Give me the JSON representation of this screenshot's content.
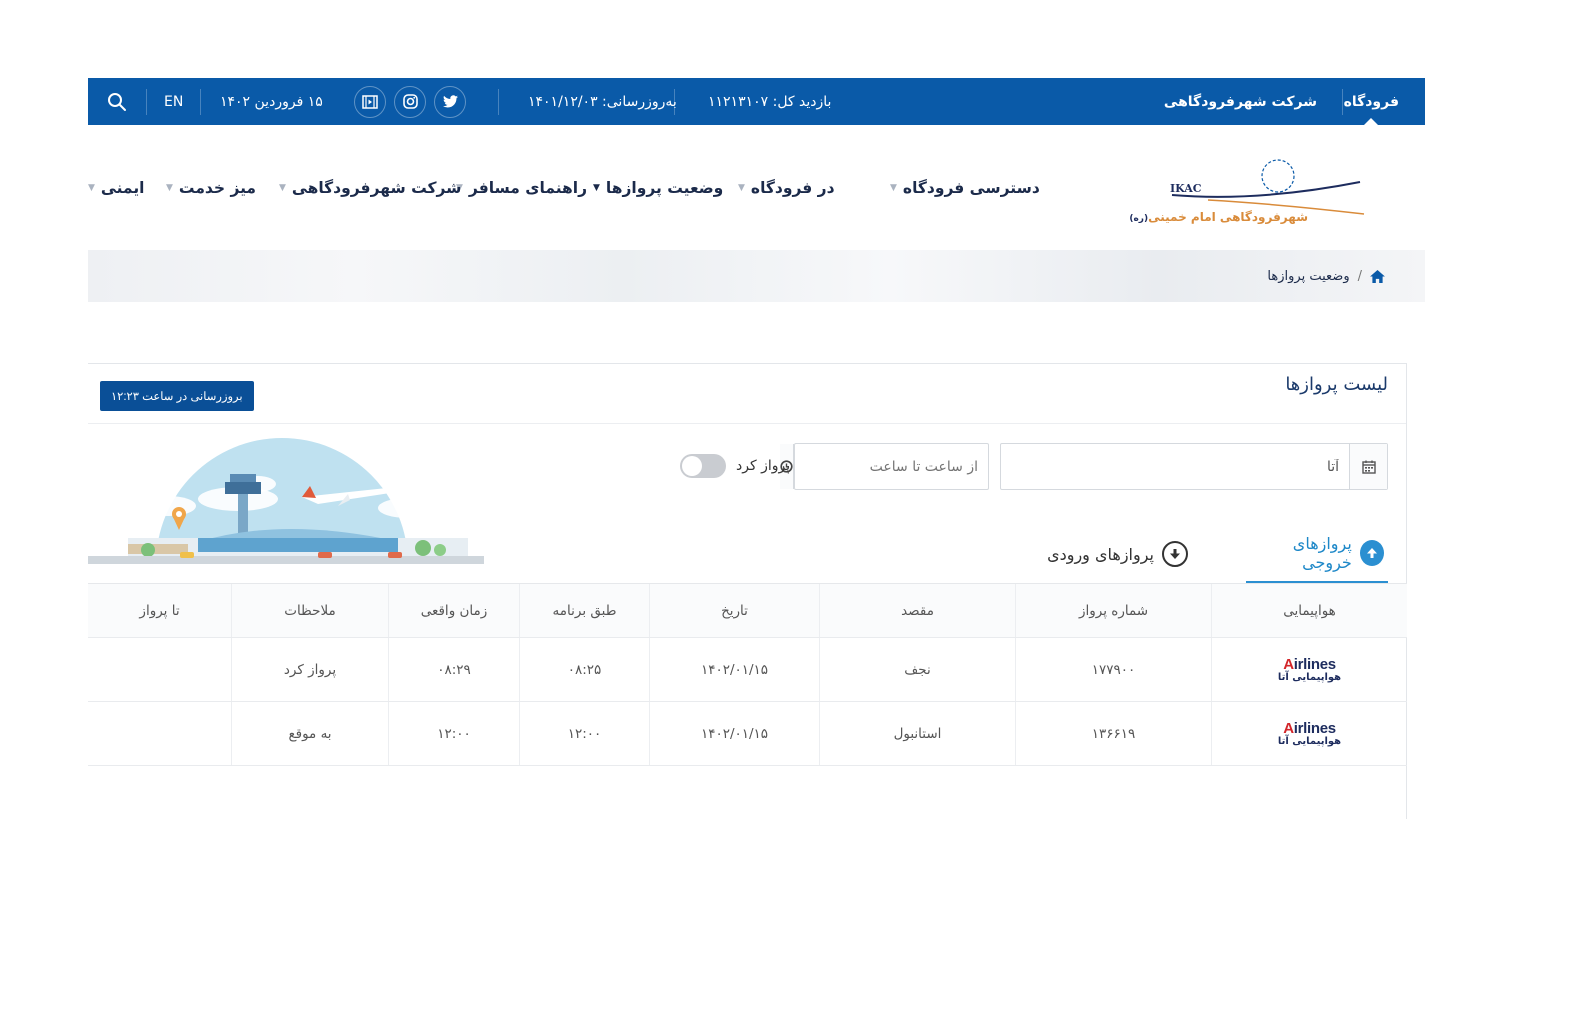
{
  "topbar": {
    "airport": "فرودگاه",
    "company": "شرکت شهرفرودگاهی",
    "visits": "بازدید کل: ۱۱۲۱۳۱۰۷",
    "updated": "به‌روزرسانی: ۱۴۰۱/۱۲/۰۳",
    "date": "۱۵ فروردین ۱۴۰۲",
    "lang": "EN",
    "social_icons": [
      "twitter-icon",
      "instagram-icon",
      "aparat-icon"
    ]
  },
  "logo": {
    "abbr": "IKAC",
    "name": "شهرفرودگاهی امام خمینی",
    "suffix": "(ره)"
  },
  "nav": {
    "items": [
      {
        "label": "دسترسی فرودگاه"
      },
      {
        "label": "در فرودگاه"
      },
      {
        "label": "وضعیت پروازها"
      },
      {
        "label": "راهنمای مسافر"
      },
      {
        "label": "شرکت شهرفرودگاهی"
      },
      {
        "label": "میز خدمت"
      },
      {
        "label": "ایمنی"
      }
    ]
  },
  "breadcrumb": {
    "current": "وضعیت پروازها",
    "separator": "/"
  },
  "card": {
    "title": "لیست پروازها",
    "update_button": "بروزرسانی در ساعت ۱۲:۲۳"
  },
  "filters": {
    "search_value": "آتا",
    "time_placeholder": "از ساعت تا ساعت",
    "toggle_label": "پرواز کرد",
    "toggle_on": false
  },
  "tabs": {
    "outgoing": "پروازهای خروجی",
    "incoming": "پروازهای ورودی",
    "active": "outgoing"
  },
  "table": {
    "headers": [
      "هواپیمایی",
      "شماره پرواز",
      "مقصد",
      "تاریخ",
      "طبق برنامه",
      "زمان واقعی",
      "ملاحظات",
      "تا پرواز"
    ],
    "airline_logo": {
      "latin_prefix": "A",
      "latin_rest": "irlines",
      "persian": "هواپیمایی آتا"
    },
    "rows": [
      {
        "flight": "۱۷۷۹۰۰",
        "destination": "نجف",
        "date": "۱۴۰۲/۰۱/۱۵",
        "scheduled": "۰۸:۲۵",
        "actual": "۰۸:۲۹",
        "remarks": "پرواز کرد",
        "until": ""
      },
      {
        "flight": "۱۳۶۶۱۹",
        "destination": "استانبول",
        "date": "۱۴۰۲/۰۱/۱۵",
        "scheduled": "۱۲:۰۰",
        "actual": "۱۲:۰۰",
        "remarks": "به موقع",
        "until": ""
      }
    ]
  },
  "colors": {
    "topbar": "#0a5aa8",
    "accent": "#2b8fd1",
    "button": "#0a4f97",
    "nav_text": "#1b2a4a"
  }
}
